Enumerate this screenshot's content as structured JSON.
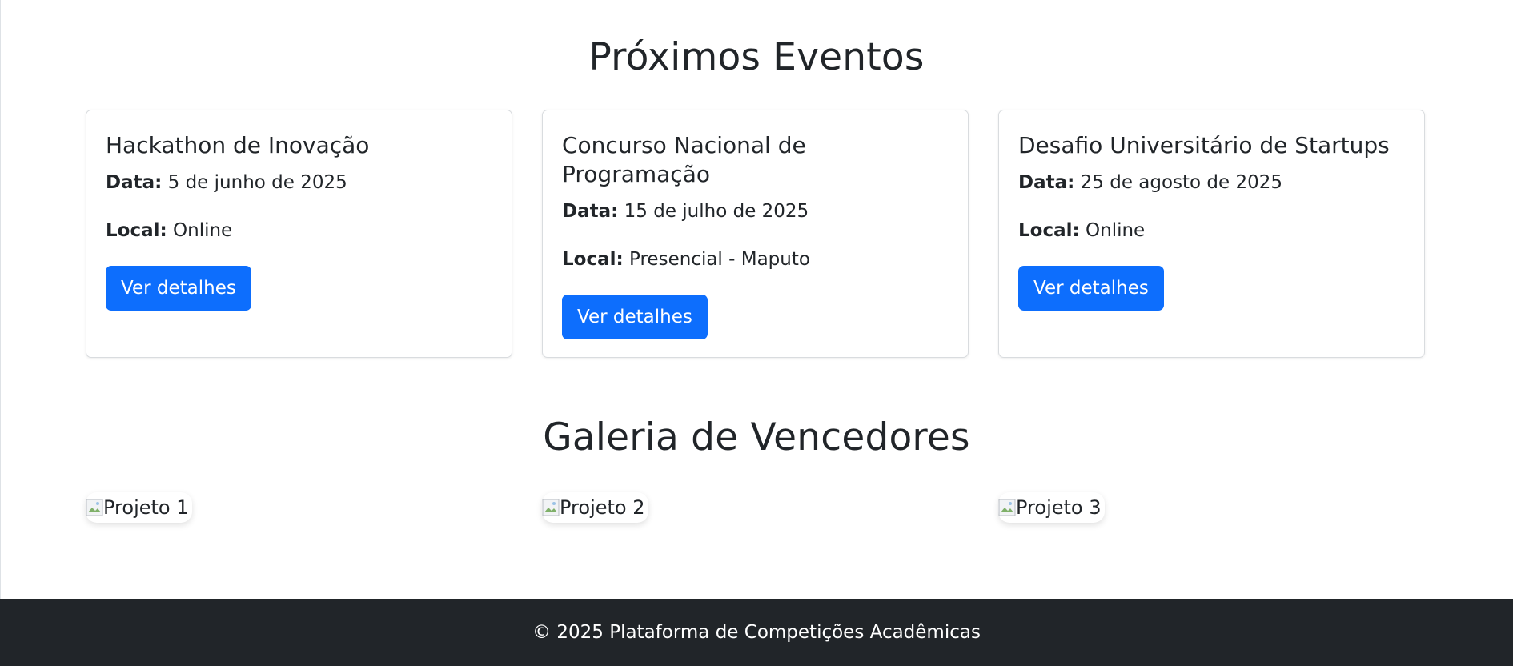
{
  "events": {
    "title": "Próximos Eventos",
    "items": [
      {
        "title": "Hackathon de Inovação",
        "date_label": "Data:",
        "date": "5 de junho de 2025",
        "location_label": "Local:",
        "location": "Online",
        "button_label": "Ver detalhes"
      },
      {
        "title": "Concurso Nacional de Programação",
        "date_label": "Data:",
        "date": "15 de julho de 2025",
        "location_label": "Local:",
        "location": "Presencial - Maputo",
        "button_label": "Ver detalhes"
      },
      {
        "title": "Desafio Universitário de Startups",
        "date_label": "Data:",
        "date": "25 de agosto de 2025",
        "location_label": "Local:",
        "location": "Online",
        "button_label": "Ver detalhes"
      }
    ]
  },
  "gallery": {
    "title": "Galeria de Vencedores",
    "items": [
      {
        "alt": "Projeto 1",
        "icon": "broken-image-icon"
      },
      {
        "alt": "Projeto 2",
        "icon": "broken-image-icon"
      },
      {
        "alt": "Projeto 3",
        "icon": "broken-image-icon"
      }
    ]
  },
  "footer": {
    "text": "© 2025 Plataforma de Competições Acadêmicas"
  },
  "colors": {
    "primary": "#0d6efd",
    "text": "#212529",
    "footer_bg": "#212529",
    "card_border": "#d9dcdf"
  }
}
